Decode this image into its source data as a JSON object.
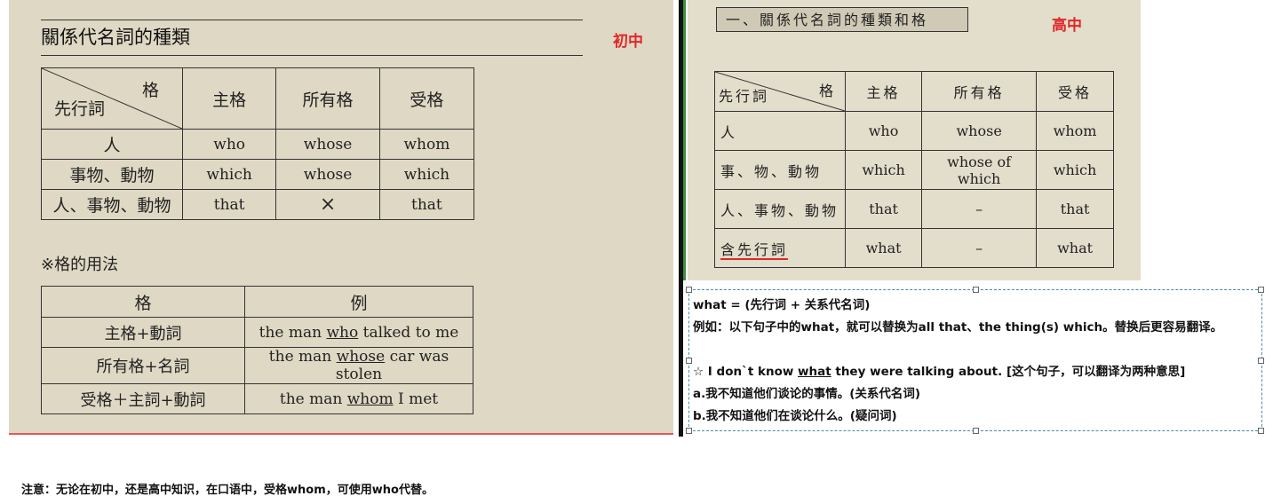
{
  "left": {
    "title": "關係代名詞的種類",
    "tag": "初中",
    "table1": {
      "corner_top": "格",
      "corner_bottom": "先行詞",
      "headers": [
        "主格",
        "所有格",
        "受格"
      ],
      "rows": [
        {
          "label": "人",
          "cells": [
            "who",
            "whose",
            "whom"
          ]
        },
        {
          "label": "事物、動物",
          "cells": [
            "which",
            "whose",
            "which"
          ]
        },
        {
          "label": "人、事物、動物",
          "cells": [
            "that",
            "×",
            "that"
          ]
        }
      ]
    },
    "note": "※格的用法",
    "table2": {
      "headers": [
        "格",
        "例"
      ],
      "rows": [
        {
          "label": "主格+動詞",
          "pre": "the man ",
          "u": "who",
          "post": " talked to me"
        },
        {
          "label": "所有格+名詞",
          "pre": "the man ",
          "u": "whose",
          "post": " car was stolen"
        },
        {
          "label": "受格＋主詞+動詞",
          "pre": "the man ",
          "u": "whom",
          "post": " I met"
        }
      ]
    }
  },
  "right": {
    "title": "一、關係代名詞的種類和格",
    "tag": "高中",
    "table": {
      "corner_top": "格",
      "corner_bottom": "先行詞",
      "headers": [
        "主格",
        "所有格",
        "受格"
      ],
      "rows": [
        {
          "label": "人",
          "cells": [
            "who",
            "whose",
            "whom"
          ]
        },
        {
          "label": "事、物、動物",
          "cells": [
            "which",
            "whose of which",
            "which"
          ]
        },
        {
          "label": "人、事物、動物",
          "cells": [
            "that",
            "–",
            "that"
          ]
        },
        {
          "label": "含先行詞",
          "cells": [
            "what",
            "–",
            "what"
          ]
        }
      ]
    }
  },
  "textbox": {
    "line1": "what = (先行词 + 关系代名词)",
    "line2": "例如：以下句子中的what，就可以替换为all that、the thing(s) which。替换后更容易翻译。",
    "line4_pre": "☆ I don`t know ",
    "line4_u": "what",
    "line4_post": " they were talking about. [这个句子，可以翻译为两种意思]",
    "line5": "a.我不知道他们谈论的事情。(关系代名词)",
    "line6": "b.我不知道他们在谈论什么。(疑问词)"
  },
  "footnote": "注意：无论在初中，还是高中知识，在口语中，受格whom，可使用who代替。",
  "colors": {
    "accent_red": "#e0282a",
    "paper": "#dfd8c4",
    "border_blue": "#4a8aa8"
  }
}
